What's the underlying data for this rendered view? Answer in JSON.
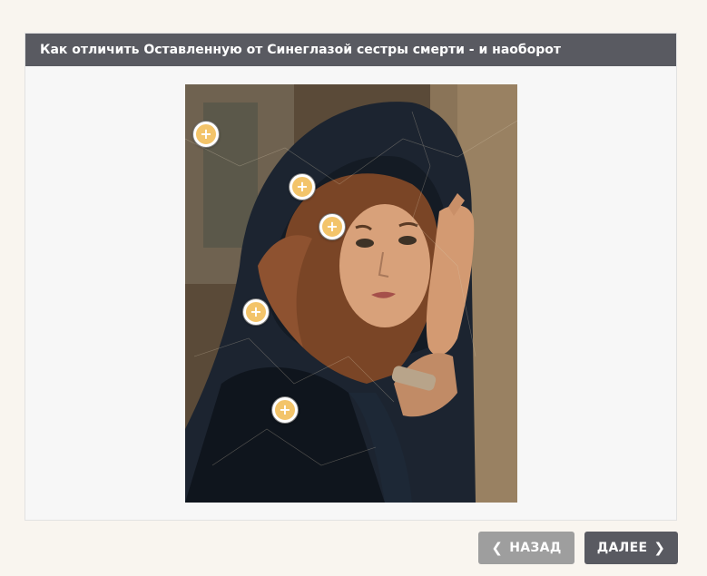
{
  "panel": {
    "title": "Как отличить Оставленную от Синеглазой сестры смерти - и наоборот"
  },
  "hotspots": [
    {
      "icon": "plus-icon",
      "symbol": "+"
    },
    {
      "icon": "plus-icon",
      "symbol": "+"
    },
    {
      "icon": "plus-icon",
      "symbol": "+"
    },
    {
      "icon": "plus-icon",
      "symbol": "+"
    },
    {
      "icon": "plus-icon",
      "symbol": "+"
    }
  ],
  "nav": {
    "back_label": "НАЗАД",
    "next_label": "ДАЛЕЕ",
    "back_icon": "chevron-left-icon",
    "next_icon": "chevron-right-icon",
    "back_chevron": "❮",
    "next_chevron": "❯"
  },
  "colors": {
    "header_bg": "#595a61",
    "hotspot_fill": "#f3c46a",
    "back_button": "#9e9e9e",
    "next_button": "#595a61"
  }
}
